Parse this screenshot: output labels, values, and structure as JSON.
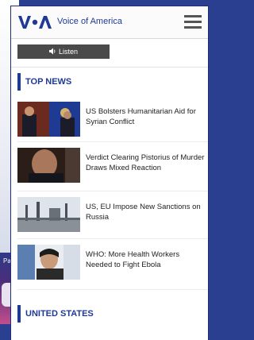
{
  "header": {
    "logo_text": "VOA",
    "brand_name": "Voice of America"
  },
  "listen": {
    "label": "Listen",
    "icon": "speaker-icon"
  },
  "sections": {
    "top_news": "TOP NEWS",
    "united_states": "UNITED STATES"
  },
  "stories": [
    {
      "headline": "US Bolsters Humanitarian Aid for Syrian Conflict"
    },
    {
      "headline": "Verdict Clearing Pistorius of Murder Draws Mixed Reaction"
    },
    {
      "headline": "US, EU Impose New Sanctions on Russia"
    },
    {
      "headline": "WHO: More Health Workers Needed to Fight Ebola"
    }
  ],
  "background_tag": "Pa",
  "colors": {
    "brand": "#1f3a93",
    "frame": "#2a3f8f",
    "button": "#4a4a4a"
  }
}
